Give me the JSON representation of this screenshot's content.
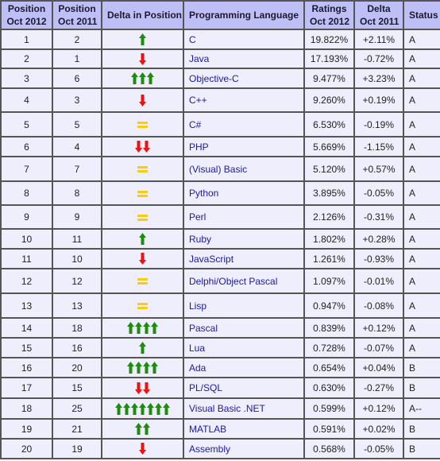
{
  "colors": {
    "header_bg": "#bfbff7",
    "cell_bg": "#eeeefc",
    "border": "#555555",
    "language_link": "#1a1aa6",
    "arrow_up": "#1f8c0f",
    "arrow_down": "#ee1111",
    "equal": "#ffcc00"
  },
  "table": {
    "headers": {
      "pos2012_line1": "Position",
      "pos2012_line2": "Oct 2012",
      "pos2011_line1": "Position",
      "pos2011_line2": "Oct 2011",
      "delta_position": "Delta in Position",
      "language": "Programming Language",
      "ratings_line1": "Ratings",
      "ratings_line2": "Oct 2012",
      "delta_line1": "Delta",
      "delta_line2": "Oct 2011",
      "status": "Status"
    },
    "rows": [
      {
        "pos2012": "1",
        "pos2011": "2",
        "trend": "up",
        "trend_count": 1,
        "language": "C",
        "rating": "19.822%",
        "delta": "+2.11%",
        "status": "A"
      },
      {
        "pos2012": "2",
        "pos2011": "1",
        "trend": "down",
        "trend_count": 1,
        "language": "Java",
        "rating": "17.193%",
        "delta": "-0.72%",
        "status": "A"
      },
      {
        "pos2012": "3",
        "pos2011": "6",
        "trend": "up",
        "trend_count": 3,
        "language": "Objective-C",
        "rating": "9.477%",
        "delta": "+3.23%",
        "status": "A"
      },
      {
        "pos2012": "4",
        "pos2011": "3",
        "trend": "down",
        "trend_count": 1,
        "language": "C++",
        "rating": "9.260%",
        "delta": "+0.19%",
        "status": "A"
      },
      {
        "pos2012": "5",
        "pos2011": "5",
        "trend": "equal",
        "trend_count": 1,
        "language": "C#",
        "rating": "6.530%",
        "delta": "-0.19%",
        "status": "A"
      },
      {
        "pos2012": "6",
        "pos2011": "4",
        "trend": "down",
        "trend_count": 2,
        "language": "PHP",
        "rating": "5.669%",
        "delta": "-1.15%",
        "status": "A"
      },
      {
        "pos2012": "7",
        "pos2011": "7",
        "trend": "equal",
        "trend_count": 1,
        "language": "(Visual) Basic",
        "rating": "5.120%",
        "delta": "+0.57%",
        "status": "A"
      },
      {
        "pos2012": "8",
        "pos2011": "8",
        "trend": "equal",
        "trend_count": 1,
        "language": "Python",
        "rating": "3.895%",
        "delta": "-0.05%",
        "status": "A"
      },
      {
        "pos2012": "9",
        "pos2011": "9",
        "trend": "equal",
        "trend_count": 1,
        "language": "Perl",
        "rating": "2.126%",
        "delta": "-0.31%",
        "status": "A"
      },
      {
        "pos2012": "10",
        "pos2011": "11",
        "trend": "up",
        "trend_count": 1,
        "language": "Ruby",
        "rating": "1.802%",
        "delta": "+0.28%",
        "status": "A"
      },
      {
        "pos2012": "11",
        "pos2011": "10",
        "trend": "down",
        "trend_count": 1,
        "language": "JavaScript",
        "rating": "1.261%",
        "delta": "-0.93%",
        "status": "A"
      },
      {
        "pos2012": "12",
        "pos2011": "12",
        "trend": "equal",
        "trend_count": 1,
        "language": "Delphi/Object Pascal",
        "rating": "1.097%",
        "delta": "-0.01%",
        "status": "A"
      },
      {
        "pos2012": "13",
        "pos2011": "13",
        "trend": "equal",
        "trend_count": 1,
        "language": "Lisp",
        "rating": "0.947%",
        "delta": "-0.08%",
        "status": "A"
      },
      {
        "pos2012": "14",
        "pos2011": "18",
        "trend": "up",
        "trend_count": 4,
        "language": "Pascal",
        "rating": "0.839%",
        "delta": "+0.12%",
        "status": "A"
      },
      {
        "pos2012": "15",
        "pos2011": "16",
        "trend": "up",
        "trend_count": 1,
        "language": "Lua",
        "rating": "0.728%",
        "delta": "-0.07%",
        "status": "A"
      },
      {
        "pos2012": "16",
        "pos2011": "20",
        "trend": "up",
        "trend_count": 4,
        "language": "Ada",
        "rating": "0.654%",
        "delta": "+0.04%",
        "status": "B"
      },
      {
        "pos2012": "17",
        "pos2011": "15",
        "trend": "down",
        "trend_count": 2,
        "language": "PL/SQL",
        "rating": "0.630%",
        "delta": "-0.27%",
        "status": "B"
      },
      {
        "pos2012": "18",
        "pos2011": "25",
        "trend": "up",
        "trend_count": 7,
        "language": "Visual Basic .NET",
        "rating": "0.599%",
        "delta": "+0.12%",
        "status": "A--"
      },
      {
        "pos2012": "19",
        "pos2011": "21",
        "trend": "up",
        "trend_count": 2,
        "language": "MATLAB",
        "rating": "0.591%",
        "delta": "+0.02%",
        "status": "B"
      },
      {
        "pos2012": "20",
        "pos2011": "19",
        "trend": "down",
        "trend_count": 1,
        "language": "Assembly",
        "rating": "0.568%",
        "delta": "-0.05%",
        "status": "B"
      }
    ]
  }
}
